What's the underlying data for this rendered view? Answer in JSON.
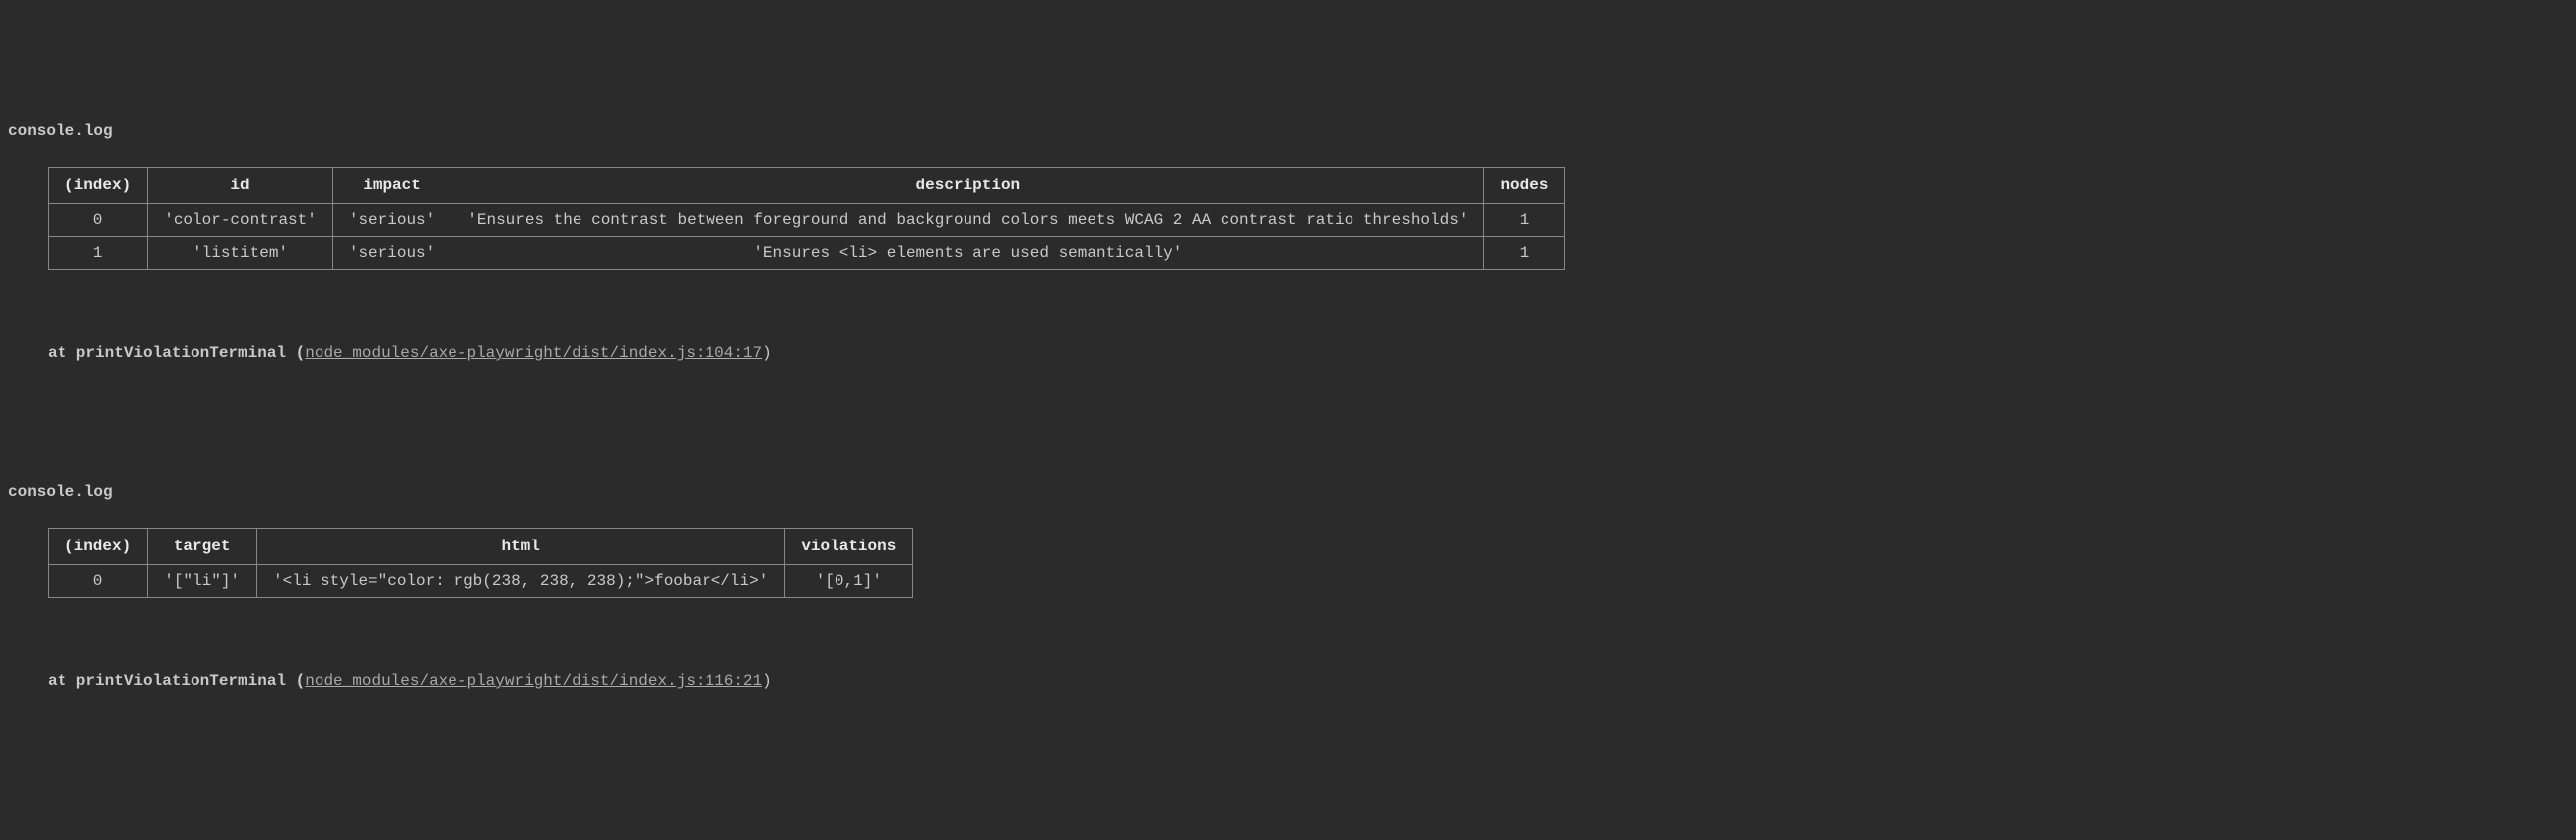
{
  "logs": [
    {
      "label": "console.log",
      "table": {
        "headers": [
          "(index)",
          "id",
          "impact",
          "description",
          "nodes"
        ],
        "rows": [
          [
            "0",
            "'color-contrast'",
            "'serious'",
            "'Ensures the contrast between foreground and background colors meets WCAG 2 AA contrast ratio thresholds'",
            "1"
          ],
          [
            "1",
            "'listitem'",
            "'serious'",
            "'Ensures <li> elements are used semantically'",
            "1"
          ]
        ]
      },
      "trace": {
        "prefix": "at printViolationTerminal (",
        "link": "node_modules/axe-playwright/dist/index.js:104:17",
        "suffix": ")"
      }
    },
    {
      "label": "console.log",
      "table": {
        "headers": [
          "(index)",
          "target",
          "html",
          "violations"
        ],
        "rows": [
          [
            "0",
            "'[\"li\"]'",
            "'<li style=\"color: rgb(238, 238, 238);\">foobar</li>'",
            "'[0,1]'"
          ]
        ]
      },
      "trace": {
        "prefix": "at printViolationTerminal (",
        "link": "node_modules/axe-playwright/dist/index.js:116:21",
        "suffix": ")"
      }
    }
  ]
}
